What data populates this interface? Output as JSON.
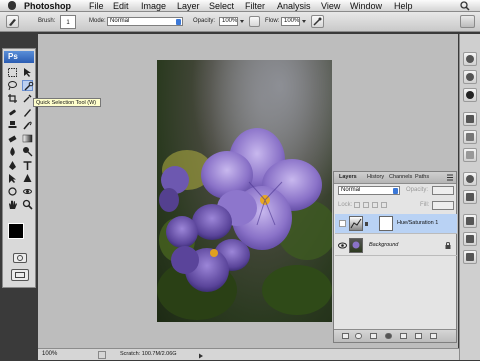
{
  "menubar": {
    "app": "Photoshop",
    "items": [
      "File",
      "Edit",
      "Image",
      "Layer",
      "Select",
      "Filter",
      "Analysis",
      "View",
      "Window",
      "Help"
    ]
  },
  "options": {
    "brush_label": "Brush:",
    "brush_size": "1",
    "mode_label": "Mode:",
    "mode_value": "Normal",
    "opacity_label": "Opacity:",
    "opacity_value": "100%",
    "flow_label": "Flow:",
    "flow_value": "100%"
  },
  "toolbox": {
    "logo": "Ps"
  },
  "tooltip": "Quick Selection Tool (W)",
  "layers_panel": {
    "tabs": [
      "Layers",
      "History",
      "Channels",
      "Paths"
    ],
    "blend_mode": "Normal",
    "opacity_label": "Opacity:",
    "lock_label": "Lock:",
    "fill_label": "Fill:",
    "layers": [
      {
        "name": "Hue/Saturation 1",
        "selected": true
      },
      {
        "name": "Background",
        "selected": false
      }
    ]
  },
  "status": {
    "zoom": "100%",
    "scratch": "Scratch: 100.7M/2.06G"
  },
  "colors": {
    "accent": "#3b78d8",
    "canvas_bg": "#bdbdbd",
    "flower_purple": "#8a72c8"
  }
}
